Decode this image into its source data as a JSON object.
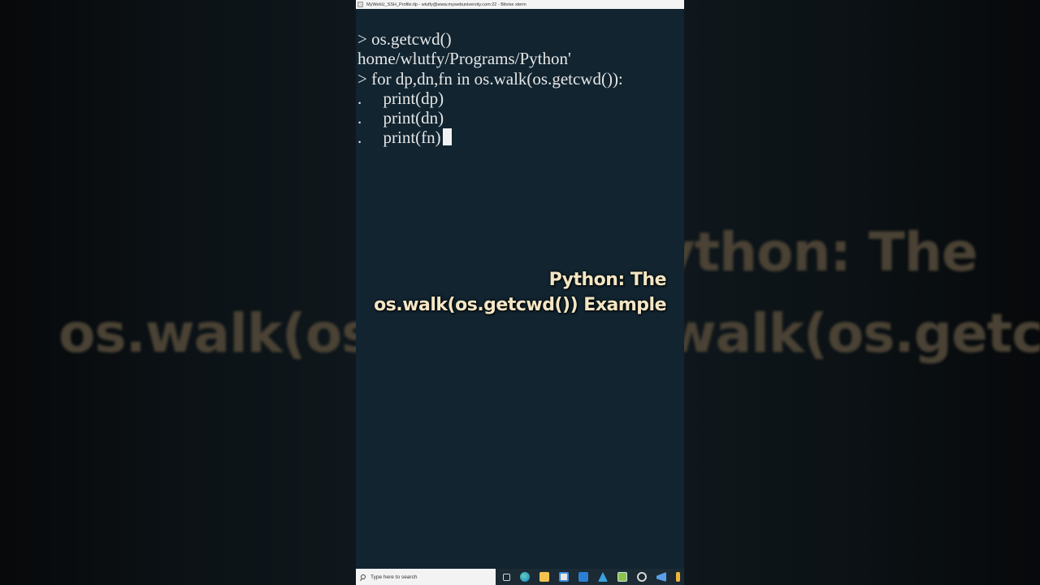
{
  "window": {
    "title": "MyWebU_SSH_Profile.tlp - wlutfy@www.mywebuniversity.com:22 - Bitvise xterm"
  },
  "terminal": {
    "lines": [
      "> os.getcwd()",
      "home/wlutfy/Programs/Python'",
      "> for dp,dn,fn in os.walk(os.getcwd()):",
      ".     print(dp)",
      ".     print(dn)",
      ".     print(fn)"
    ]
  },
  "caption": {
    "line1": "Python: The",
    "line2": "os.walk(os.getcwd()) Example"
  },
  "background": {
    "line1": "Python: The",
    "line2": "os.walk(os.getcwd()) Example"
  },
  "taskbar": {
    "search_placeholder": "Type here to search",
    "icons": [
      "task-view-icon",
      "edge-icon",
      "folder-icon",
      "store-icon",
      "mail-icon",
      "app-icon",
      "app-icon",
      "app-icon",
      "app-icon",
      "app-icon"
    ]
  },
  "colors": {
    "terminal_bg": "#112430",
    "terminal_fg": "#e6e6e6",
    "caption": "#f3e6c4"
  }
}
